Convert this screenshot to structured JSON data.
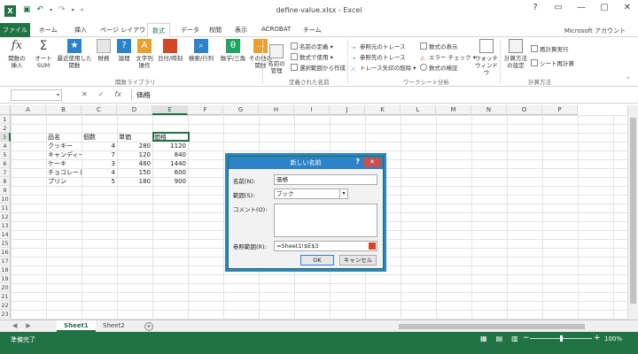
{
  "titlebar": {
    "logo": "X",
    "qat": [
      "save-icon",
      "undo-icon",
      "redo-icon"
    ],
    "title": "define-value.xlsx - Excel",
    "controls": [
      "?",
      "▭",
      "—",
      "▢",
      "✕"
    ]
  },
  "tabs": {
    "file": "ファイル",
    "items": [
      "ホーム",
      "挿入",
      "ページ レイアウト",
      "数式",
      "データ",
      "校閲",
      "表示",
      "ACROBAT",
      "チーム"
    ],
    "active": "数式",
    "account": "Microsoft アカウント"
  },
  "ribbon": {
    "groups": {
      "function_library": "関数ライブラリ",
      "defined_names": "定義された名前",
      "auditing": "ワークシート分析",
      "calculation": "計算方法"
    },
    "buttons": {
      "insert_function": "関数の\n挿入",
      "autosum": "オート\nSUM",
      "recent": "最近使用した\n関数",
      "financial": "財務",
      "logical": "論理",
      "text": "文字列\n操作",
      "datetime": "日付/時刻",
      "lookup": "検索/行列",
      "math": "数学/三角",
      "more": "その他の\n関数",
      "name_manager": "名前の\n管理",
      "watch": "ウォッチ\nウィンドウ",
      "calc_options": "計算方法\nの設定"
    },
    "small": {
      "define_name": "名前の定義",
      "use_in_formula": "数式で使用",
      "create_from_selection": "選択範囲から作成",
      "trace_precedents": "参照元のトレース",
      "trace_dependents": "参照先のトレース",
      "remove_arrows": "トレース矢印の削除",
      "show_formulas": "数式の表示",
      "error_checking": "エラー チェック",
      "evaluate_formula": "数式の検証",
      "calc_now": "再計算実行",
      "calc_sheet": "シート再計算"
    }
  },
  "formula_bar": {
    "namebox_value": "",
    "fx": "fx",
    "content": "価格"
  },
  "grid": {
    "columns": [
      "A",
      "B",
      "C",
      "D",
      "E",
      "F",
      "G",
      "H",
      "I",
      "J",
      "K",
      "L",
      "M",
      "N",
      "O",
      "P"
    ],
    "selected_column": "E",
    "rows": [
      "1",
      "2",
      "3",
      "4",
      "5",
      "6",
      "7",
      "8",
      "9",
      "10",
      "11",
      "12",
      "13",
      "14",
      "15",
      "16",
      "17",
      "18",
      "19",
      "20",
      "21",
      "22",
      "23"
    ],
    "selected_row": "3",
    "header": [
      "品名",
      "個数",
      "単価",
      "価格"
    ],
    "data": [
      [
        "クッキー",
        "4",
        "280",
        "1120"
      ],
      [
        "キャンディー",
        "7",
        "120",
        "840"
      ],
      [
        "ケーキ",
        "3",
        "480",
        "1440"
      ],
      [
        "チョコレート",
        "4",
        "150",
        "600"
      ],
      [
        "プリン",
        "5",
        "180",
        "900"
      ]
    ]
  },
  "sheets": {
    "tabs": [
      "Sheet1",
      "Sheet2"
    ],
    "active": "Sheet1",
    "add": "+"
  },
  "status": {
    "ready": "準備完了",
    "zoom": "100%",
    "zoom_fraction": 0.5
  },
  "dialog": {
    "title": "新しい名前",
    "help": "?",
    "close": "✕",
    "name_label": "名前(N):",
    "name_value": "価格",
    "scope_label": "範囲(S):",
    "scope_value": "ブック",
    "comment_label": "コメント(O):",
    "comment_value": "",
    "refers_label": "参照範囲(R):",
    "refers_value": "=Sheet1!$E$3",
    "ok": "OK",
    "cancel": "キャンセル"
  },
  "colors": {
    "accent": "#217346",
    "dialog_title": "#2d83c9",
    "close_red": "#c75050"
  }
}
